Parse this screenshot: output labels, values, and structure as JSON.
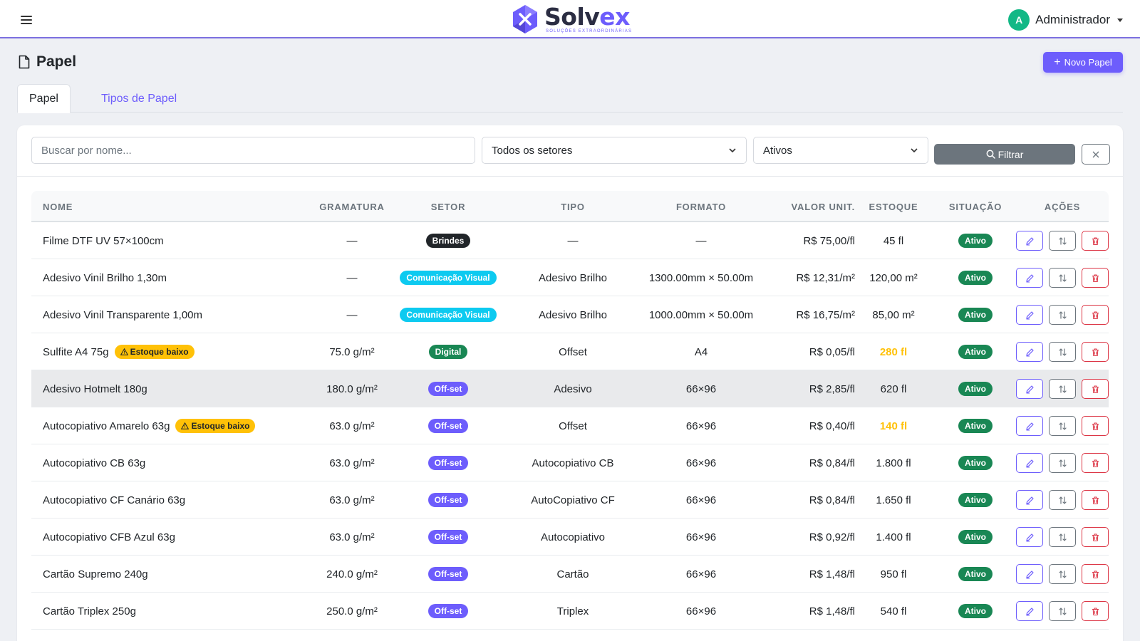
{
  "header": {
    "brand_prefix": "Solv",
    "brand_suffix": "ex",
    "brand_tagline": "SOLUÇÕES EXTRAORDINÁRIAS",
    "user_initial": "A",
    "user_name": "Administrador"
  },
  "page": {
    "title": "Papel",
    "new_button": "Novo Papel"
  },
  "tabs": [
    {
      "label": "Papel",
      "active": true
    },
    {
      "label": "Tipos de Papel",
      "active": false
    }
  ],
  "filters": {
    "search_placeholder": "Buscar por nome...",
    "search_value": "",
    "sector_selected": "Todos os setores",
    "status_selected": "Ativos",
    "filter_button": "Filtrar"
  },
  "table": {
    "headers": {
      "nome": "NOME",
      "gramatura": "GRAMATURA",
      "setor": "SETOR",
      "tipo": "TIPO",
      "formato": "FORMATO",
      "valor": "VALOR UNIT.",
      "estoque": "ESTOQUE",
      "situacao": "SITUAÇÃO",
      "acoes": "AÇÕES"
    },
    "rows": [
      {
        "nome": "Filme DTF UV 57×100cm",
        "warning": "",
        "gramatura": "—",
        "setor": "Brindes",
        "setor_color": "#212529",
        "tipo": "—",
        "formato": "—",
        "valor": "R$ 75,00/fl",
        "estoque": "45 fl",
        "low": false,
        "situacao": "Ativo"
      },
      {
        "nome": "Adesivo Vinil Brilho 1,30m",
        "warning": "",
        "gramatura": "—",
        "setor": "Comunicação Visual",
        "setor_color": "#0dcaf0",
        "tipo": "Adesivo Brilho",
        "formato": "1300.00mm × 50.00m",
        "valor": "R$ 12,31/m²",
        "estoque": "120,00 m²",
        "low": false,
        "situacao": "Ativo"
      },
      {
        "nome": "Adesivo Vinil Transparente 1,00m",
        "warning": "",
        "gramatura": "—",
        "setor": "Comunicação Visual",
        "setor_color": "#0dcaf0",
        "tipo": "Adesivo Brilho",
        "formato": "1000.00mm × 50.00m",
        "valor": "R$ 16,75/m²",
        "estoque": "85,00 m²",
        "low": false,
        "situacao": "Ativo"
      },
      {
        "nome": "Sulfite A4 75g",
        "warning": "Estoque baixo",
        "gramatura": "75.0 g/m²",
        "setor": "Digital",
        "setor_color": "#198754",
        "tipo": "Offset",
        "formato": "A4",
        "valor": "R$ 0,05/fl",
        "estoque": "280 fl",
        "low": true,
        "situacao": "Ativo"
      },
      {
        "nome": "Adesivo Hotmelt 180g",
        "warning": "",
        "gramatura": "180.0 g/m²",
        "setor": "Off-set",
        "setor_color": "#6d5dfc",
        "tipo": "Adesivo",
        "formato": "66×96",
        "valor": "R$ 2,85/fl",
        "estoque": "620 fl",
        "low": false,
        "situacao": "Ativo",
        "hover": true
      },
      {
        "nome": "Autocopiativo Amarelo 63g",
        "warning": "Estoque baixo",
        "gramatura": "63.0 g/m²",
        "setor": "Off-set",
        "setor_color": "#6d5dfc",
        "tipo": "Offset",
        "formato": "66×96",
        "valor": "R$ 0,40/fl",
        "estoque": "140 fl",
        "low": true,
        "situacao": "Ativo"
      },
      {
        "nome": "Autocopiativo CB 63g",
        "warning": "",
        "gramatura": "63.0 g/m²",
        "setor": "Off-set",
        "setor_color": "#6d5dfc",
        "tipo": "Autocopiativo CB",
        "formato": "66×96",
        "valor": "R$ 0,84/fl",
        "estoque": "1.800 fl",
        "low": false,
        "situacao": "Ativo"
      },
      {
        "nome": "Autocopiativo CF Canário 63g",
        "warning": "",
        "gramatura": "63.0 g/m²",
        "setor": "Off-set",
        "setor_color": "#6d5dfc",
        "tipo": "AutoCopiativo CF",
        "formato": "66×96",
        "valor": "R$ 0,84/fl",
        "estoque": "1.650 fl",
        "low": false,
        "situacao": "Ativo"
      },
      {
        "nome": "Autocopiativo CFB Azul 63g",
        "warning": "",
        "gramatura": "63.0 g/m²",
        "setor": "Off-set",
        "setor_color": "#6d5dfc",
        "tipo": "Autocopiativo",
        "formato": "66×96",
        "valor": "R$ 0,92/fl",
        "estoque": "1.400 fl",
        "low": false,
        "situacao": "Ativo"
      },
      {
        "nome": "Cartão Supremo 240g",
        "warning": "",
        "gramatura": "240.0 g/m²",
        "setor": "Off-set",
        "setor_color": "#6d5dfc",
        "tipo": "Cartão",
        "formato": "66×96",
        "valor": "R$ 1,48/fl",
        "estoque": "950 fl",
        "low": false,
        "situacao": "Ativo"
      },
      {
        "nome": "Cartão Triplex 250g",
        "warning": "",
        "gramatura": "250.0 g/m²",
        "setor": "Off-set",
        "setor_color": "#6d5dfc",
        "tipo": "Triplex",
        "formato": "66×96",
        "valor": "R$ 1,48/fl",
        "estoque": "540 fl",
        "low": false,
        "situacao": "Ativo"
      }
    ]
  },
  "icons": {
    "menu": "hamburger-icon",
    "title": "file-icon",
    "search": "search-icon",
    "clear": "close-icon",
    "edit": "pencil-icon",
    "move": "swap-vertical-icon",
    "delete": "trash-icon",
    "warning": "alert-triangle-icon"
  },
  "colors": {
    "accent": "#6d5dfc",
    "success": "#198754",
    "warning": "#ffc107",
    "danger": "#dc3545",
    "info": "#0dcaf0"
  }
}
